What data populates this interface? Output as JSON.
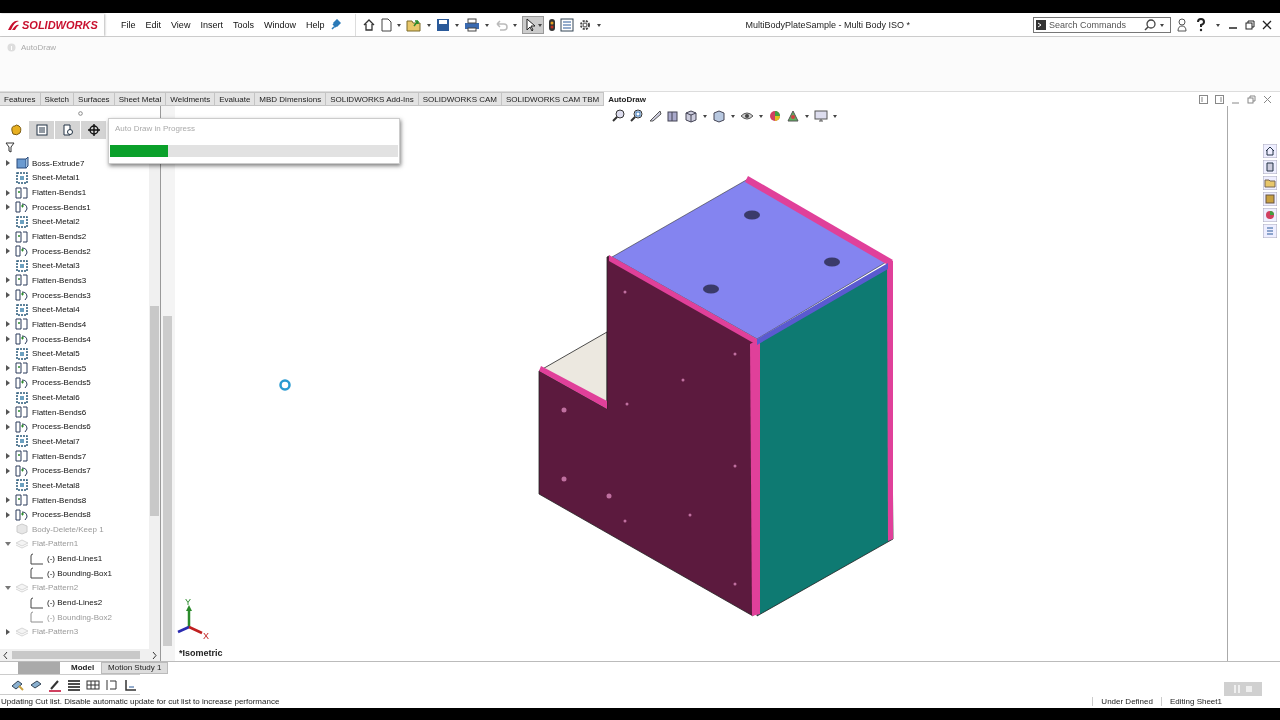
{
  "title_bar": {
    "app_name": "SOLIDWORKS",
    "menu": [
      "File",
      "Edit",
      "View",
      "Insert",
      "Tools",
      "Window",
      "Help"
    ],
    "document_title": "MultiBodyPlateSample - Multi Body ISO *",
    "search": {
      "placeholder": "Search Commands"
    }
  },
  "ribbon": {
    "label": "AutoDraw"
  },
  "command_tabs": [
    {
      "label": "Features",
      "selected": false
    },
    {
      "label": "Sketch",
      "selected": false
    },
    {
      "label": "Surfaces",
      "selected": false
    },
    {
      "label": "Sheet Metal",
      "selected": false
    },
    {
      "label": "Weldments",
      "selected": false
    },
    {
      "label": "Evaluate",
      "selected": false
    },
    {
      "label": "MBD Dimensions",
      "selected": false
    },
    {
      "label": "SOLIDWORKS Add-Ins",
      "selected": false
    },
    {
      "label": "SOLIDWORKS CAM",
      "selected": false
    },
    {
      "label": "SOLIDWORKS CAM TBM",
      "selected": false
    },
    {
      "label": "AutoDraw",
      "selected": true
    }
  ],
  "feature_tree": {
    "items": [
      {
        "label": "Boss-Extrude7",
        "kind": "boss-extrude",
        "expandable": true,
        "expanded": false,
        "suppressed": false
      },
      {
        "label": "Sheet-Metal1",
        "kind": "sheet-metal",
        "expandable": false,
        "expanded": false,
        "suppressed": false
      },
      {
        "label": "Flatten-Bends1",
        "kind": "flatten-bends",
        "expandable": true,
        "expanded": false,
        "suppressed": false
      },
      {
        "label": "Process-Bends1",
        "kind": "process-bends",
        "expandable": true,
        "expanded": false,
        "suppressed": false
      },
      {
        "label": "Sheet-Metal2",
        "kind": "sheet-metal",
        "expandable": false,
        "expanded": false,
        "suppressed": false
      },
      {
        "label": "Flatten-Bends2",
        "kind": "flatten-bends",
        "expandable": true,
        "expanded": false,
        "suppressed": false
      },
      {
        "label": "Process-Bends2",
        "kind": "process-bends",
        "expandable": true,
        "expanded": false,
        "suppressed": false
      },
      {
        "label": "Sheet-Metal3",
        "kind": "sheet-metal",
        "expandable": false,
        "expanded": false,
        "suppressed": false
      },
      {
        "label": "Flatten-Bends3",
        "kind": "flatten-bends",
        "expandable": true,
        "expanded": false,
        "suppressed": false
      },
      {
        "label": "Process-Bends3",
        "kind": "process-bends",
        "expandable": true,
        "expanded": false,
        "suppressed": false
      },
      {
        "label": "Sheet-Metal4",
        "kind": "sheet-metal",
        "expandable": false,
        "expanded": false,
        "suppressed": false
      },
      {
        "label": "Flatten-Bends4",
        "kind": "flatten-bends",
        "expandable": true,
        "expanded": false,
        "suppressed": false
      },
      {
        "label": "Process-Bends4",
        "kind": "process-bends",
        "expandable": true,
        "expanded": false,
        "suppressed": false
      },
      {
        "label": "Sheet-Metal5",
        "kind": "sheet-metal",
        "expandable": false,
        "expanded": false,
        "suppressed": false
      },
      {
        "label": "Flatten-Bends5",
        "kind": "flatten-bends",
        "expandable": true,
        "expanded": false,
        "suppressed": false
      },
      {
        "label": "Process-Bends5",
        "kind": "process-bends",
        "expandable": true,
        "expanded": false,
        "suppressed": false
      },
      {
        "label": "Sheet-Metal6",
        "kind": "sheet-metal",
        "expandable": false,
        "expanded": false,
        "suppressed": false
      },
      {
        "label": "Flatten-Bends6",
        "kind": "flatten-bends",
        "expandable": true,
        "expanded": false,
        "suppressed": false
      },
      {
        "label": "Process-Bends6",
        "kind": "process-bends",
        "expandable": true,
        "expanded": false,
        "suppressed": false
      },
      {
        "label": "Sheet-Metal7",
        "kind": "sheet-metal",
        "expandable": false,
        "expanded": false,
        "suppressed": false
      },
      {
        "label": "Flatten-Bends7",
        "kind": "flatten-bends",
        "expandable": true,
        "expanded": false,
        "suppressed": false
      },
      {
        "label": "Process-Bends7",
        "kind": "process-bends",
        "expandable": true,
        "expanded": false,
        "suppressed": false
      },
      {
        "label": "Sheet-Metal8",
        "kind": "sheet-metal",
        "expandable": false,
        "expanded": false,
        "suppressed": false
      },
      {
        "label": "Flatten-Bends8",
        "kind": "flatten-bends",
        "expandable": true,
        "expanded": false,
        "suppressed": false
      },
      {
        "label": "Process-Bends8",
        "kind": "process-bends",
        "expandable": true,
        "expanded": false,
        "suppressed": false
      },
      {
        "label": "Body-Delete/Keep 1",
        "kind": "body-delete",
        "expandable": false,
        "expanded": false,
        "suppressed": true
      },
      {
        "label": "Flat-Pattern1",
        "kind": "flat-pattern",
        "expandable": true,
        "expanded": true,
        "suppressed": true,
        "children": [
          {
            "label": "(-) Bend-Lines1",
            "kind": "sketch",
            "expandable": false,
            "expanded": false,
            "suppressed": false
          },
          {
            "label": "(-) Bounding-Box1",
            "kind": "sketch",
            "expandable": false,
            "expanded": false,
            "suppressed": false
          }
        ]
      },
      {
        "label": "Flat-Pattern2",
        "kind": "flat-pattern",
        "expandable": true,
        "expanded": true,
        "suppressed": true,
        "children": [
          {
            "label": "(-) Bend-Lines2",
            "kind": "sketch",
            "expandable": false,
            "expanded": false,
            "suppressed": false
          },
          {
            "label": "(-) Bounding-Box2",
            "kind": "sketch",
            "expandable": false,
            "expanded": false,
            "suppressed": true
          }
        ]
      },
      {
        "label": "Flat-Pattern3",
        "kind": "flat-pattern",
        "expandable": true,
        "expanded": false,
        "suppressed": true
      }
    ]
  },
  "panel_tabs": [
    {
      "selected": true
    },
    {
      "selected": false
    },
    {
      "selected": false
    },
    {
      "selected": false
    }
  ],
  "progress_dialog": {
    "title": "Auto Draw in Progress",
    "level": 0.2
  },
  "viewport": {
    "view_label": "*Isometric",
    "triad": {
      "y_label": "Y",
      "x_label": "X"
    }
  },
  "bottom_tabs": [
    {
      "label": "Model",
      "selected": true
    },
    {
      "label": "Motion Study 1",
      "selected": false
    }
  ],
  "status_bar": {
    "message": "Updating Cut list. Disable automatic update for cut list to increase performance",
    "items": [
      "Under Defined",
      "Editing Sheet1"
    ]
  }
}
